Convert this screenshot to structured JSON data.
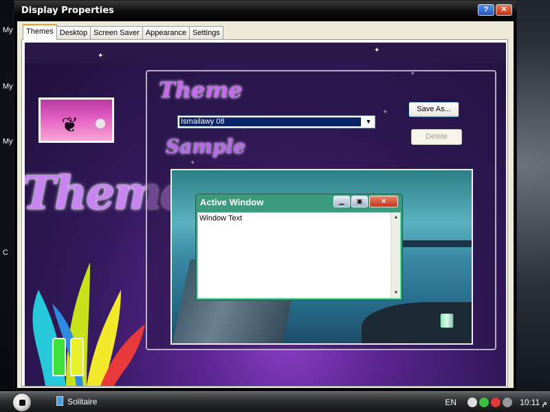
{
  "desktop": {
    "labels": [
      "My",
      "My",
      "My",
      "C"
    ]
  },
  "window": {
    "title": "Display Properties",
    "help_label": "?",
    "close_label": "✕",
    "tabs": [
      {
        "label": "Themes"
      },
      {
        "label": "Desktop"
      },
      {
        "label": "Screen Saver"
      },
      {
        "label": "Appearance"
      },
      {
        "label": "Settings"
      }
    ],
    "active_tab": "Themes"
  },
  "themes_page": {
    "banner_text": "Themes",
    "theme_heading": "Theme",
    "sample_heading": "Sample",
    "theme_select": {
      "value": "Ismailawy 08"
    },
    "save_as_label": "Save As...",
    "delete_label": "Delete"
  },
  "sample_window": {
    "title": "Active Window",
    "body_text": "Window Text"
  },
  "taskbar": {
    "task_item": "Solitaire",
    "language": "EN",
    "clock": "10:11",
    "clock_suffix": "م"
  }
}
